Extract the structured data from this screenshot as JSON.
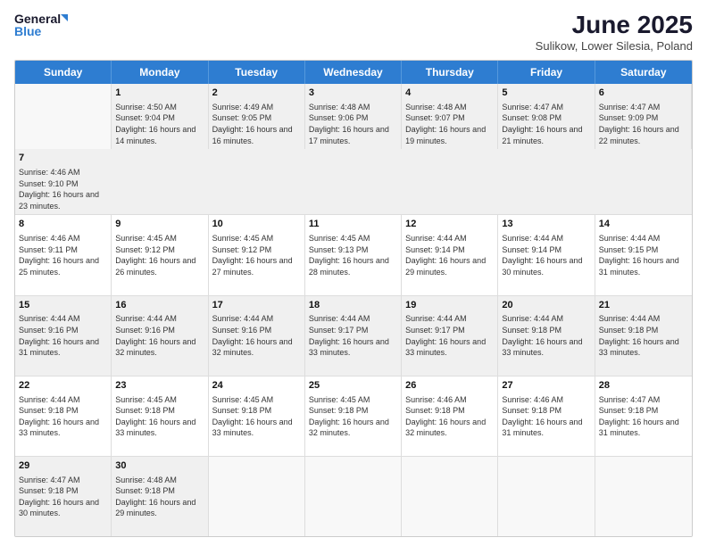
{
  "logo": {
    "general": "General",
    "blue": "Blue"
  },
  "title": "June 2025",
  "subtitle": "Sulikow, Lower Silesia, Poland",
  "headers": [
    "Sunday",
    "Monday",
    "Tuesday",
    "Wednesday",
    "Thursday",
    "Friday",
    "Saturday"
  ],
  "rows": [
    {
      "shade": "shaded",
      "cells": [
        null,
        {
          "day": "1",
          "rise": "Sunrise: 4:50 AM",
          "set": "Sunset: 9:04 PM",
          "day_text": "Daylight: 16 hours and 14 minutes."
        },
        {
          "day": "2",
          "rise": "Sunrise: 4:49 AM",
          "set": "Sunset: 9:05 PM",
          "day_text": "Daylight: 16 hours and 16 minutes."
        },
        {
          "day": "3",
          "rise": "Sunrise: 4:48 AM",
          "set": "Sunset: 9:06 PM",
          "day_text": "Daylight: 16 hours and 17 minutes."
        },
        {
          "day": "4",
          "rise": "Sunrise: 4:48 AM",
          "set": "Sunset: 9:07 PM",
          "day_text": "Daylight: 16 hours and 19 minutes."
        },
        {
          "day": "5",
          "rise": "Sunrise: 4:47 AM",
          "set": "Sunset: 9:08 PM",
          "day_text": "Daylight: 16 hours and 21 minutes."
        },
        {
          "day": "6",
          "rise": "Sunrise: 4:47 AM",
          "set": "Sunset: 9:09 PM",
          "day_text": "Daylight: 16 hours and 22 minutes."
        },
        {
          "day": "7",
          "rise": "Sunrise: 4:46 AM",
          "set": "Sunset: 9:10 PM",
          "day_text": "Daylight: 16 hours and 23 minutes."
        }
      ]
    },
    {
      "shade": "white",
      "cells": [
        {
          "day": "8",
          "rise": "Sunrise: 4:46 AM",
          "set": "Sunset: 9:11 PM",
          "day_text": "Daylight: 16 hours and 25 minutes."
        },
        {
          "day": "9",
          "rise": "Sunrise: 4:45 AM",
          "set": "Sunset: 9:12 PM",
          "day_text": "Daylight: 16 hours and 26 minutes."
        },
        {
          "day": "10",
          "rise": "Sunrise: 4:45 AM",
          "set": "Sunset: 9:12 PM",
          "day_text": "Daylight: 16 hours and 27 minutes."
        },
        {
          "day": "11",
          "rise": "Sunrise: 4:45 AM",
          "set": "Sunset: 9:13 PM",
          "day_text": "Daylight: 16 hours and 28 minutes."
        },
        {
          "day": "12",
          "rise": "Sunrise: 4:44 AM",
          "set": "Sunset: 9:14 PM",
          "day_text": "Daylight: 16 hours and 29 minutes."
        },
        {
          "day": "13",
          "rise": "Sunrise: 4:44 AM",
          "set": "Sunset: 9:14 PM",
          "day_text": "Daylight: 16 hours and 30 minutes."
        },
        {
          "day": "14",
          "rise": "Sunrise: 4:44 AM",
          "set": "Sunset: 9:15 PM",
          "day_text": "Daylight: 16 hours and 31 minutes."
        }
      ]
    },
    {
      "shade": "shaded",
      "cells": [
        {
          "day": "15",
          "rise": "Sunrise: 4:44 AM",
          "set": "Sunset: 9:16 PM",
          "day_text": "Daylight: 16 hours and 31 minutes."
        },
        {
          "day": "16",
          "rise": "Sunrise: 4:44 AM",
          "set": "Sunset: 9:16 PM",
          "day_text": "Daylight: 16 hours and 32 minutes."
        },
        {
          "day": "17",
          "rise": "Sunrise: 4:44 AM",
          "set": "Sunset: 9:16 PM",
          "day_text": "Daylight: 16 hours and 32 minutes."
        },
        {
          "day": "18",
          "rise": "Sunrise: 4:44 AM",
          "set": "Sunset: 9:17 PM",
          "day_text": "Daylight: 16 hours and 33 minutes."
        },
        {
          "day": "19",
          "rise": "Sunrise: 4:44 AM",
          "set": "Sunset: 9:17 PM",
          "day_text": "Daylight: 16 hours and 33 minutes."
        },
        {
          "day": "20",
          "rise": "Sunrise: 4:44 AM",
          "set": "Sunset: 9:18 PM",
          "day_text": "Daylight: 16 hours and 33 minutes."
        },
        {
          "day": "21",
          "rise": "Sunrise: 4:44 AM",
          "set": "Sunset: 9:18 PM",
          "day_text": "Daylight: 16 hours and 33 minutes."
        }
      ]
    },
    {
      "shade": "white",
      "cells": [
        {
          "day": "22",
          "rise": "Sunrise: 4:44 AM",
          "set": "Sunset: 9:18 PM",
          "day_text": "Daylight: 16 hours and 33 minutes."
        },
        {
          "day": "23",
          "rise": "Sunrise: 4:45 AM",
          "set": "Sunset: 9:18 PM",
          "day_text": "Daylight: 16 hours and 33 minutes."
        },
        {
          "day": "24",
          "rise": "Sunrise: 4:45 AM",
          "set": "Sunset: 9:18 PM",
          "day_text": "Daylight: 16 hours and 33 minutes."
        },
        {
          "day": "25",
          "rise": "Sunrise: 4:45 AM",
          "set": "Sunset: 9:18 PM",
          "day_text": "Daylight: 16 hours and 32 minutes."
        },
        {
          "day": "26",
          "rise": "Sunrise: 4:46 AM",
          "set": "Sunset: 9:18 PM",
          "day_text": "Daylight: 16 hours and 32 minutes."
        },
        {
          "day": "27",
          "rise": "Sunrise: 4:46 AM",
          "set": "Sunset: 9:18 PM",
          "day_text": "Daylight: 16 hours and 31 minutes."
        },
        {
          "day": "28",
          "rise": "Sunrise: 4:47 AM",
          "set": "Sunset: 9:18 PM",
          "day_text": "Daylight: 16 hours and 31 minutes."
        }
      ]
    },
    {
      "shade": "shaded",
      "cells": [
        {
          "day": "29",
          "rise": "Sunrise: 4:47 AM",
          "set": "Sunset: 9:18 PM",
          "day_text": "Daylight: 16 hours and 30 minutes."
        },
        {
          "day": "30",
          "rise": "Sunrise: 4:48 AM",
          "set": "Sunset: 9:18 PM",
          "day_text": "Daylight: 16 hours and 29 minutes."
        },
        null,
        null,
        null,
        null,
        null
      ]
    }
  ]
}
